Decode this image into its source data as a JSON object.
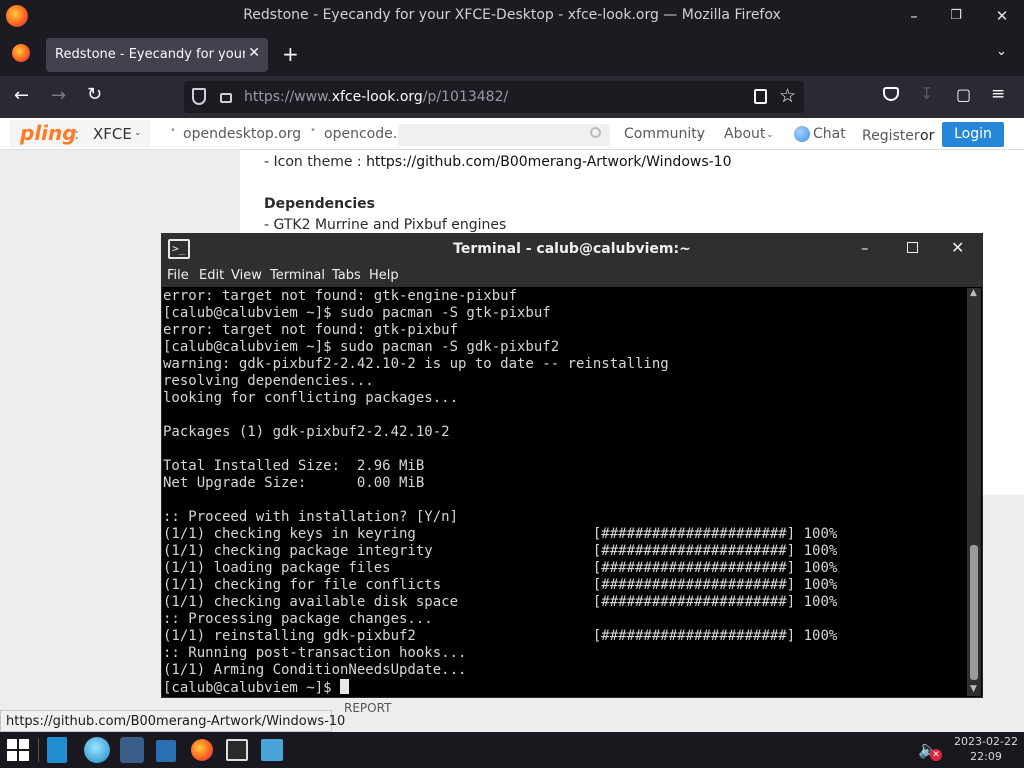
{
  "browser": {
    "window_title": "Redstone - Eyecandy for your XFCE-Desktop - xfce-look.org — Mozilla Firefox",
    "tab_title": "Redstone - Eyecandy for your XFCE-Desktop",
    "url_prefix": "https://www.",
    "url_domain": "xfce-look.org",
    "url_path": "/p/1013482/"
  },
  "site": {
    "logo": "pling",
    "section": "XFCE",
    "links": [
      "opendesktop.org",
      "opencode.net"
    ],
    "community": "Community",
    "about": "About",
    "chat": "Chat",
    "register": "Register",
    "or": "or",
    "login": "Login",
    "icon_theme_label": "- Icon theme : ",
    "icon_theme_link": "https://github.com/B00merang-Artwork/Windows-10",
    "deps_heading": "Dependencies",
    "deps_item": "- GTK2 Murrine and Pixbuf engines",
    "report": "REPORT"
  },
  "terminal": {
    "title": "Terminal - calub@calubviem:~",
    "menu": [
      "File",
      "Edit",
      "View",
      "Terminal",
      "Tabs",
      "Help"
    ],
    "lines": [
      "error: target not found: gtk-engine-pixbuf",
      "[calub@calubviem ~]$ sudo pacman -S gtk-pixbuf",
      "error: target not found: gtk-pixbuf",
      "[calub@calubviem ~]$ sudo pacman -S gdk-pixbuf2",
      "warning: gdk-pixbuf2-2.42.10-2 is up to date -- reinstalling",
      "resolving dependencies...",
      "looking for conflicting packages...",
      "",
      "Packages (1) gdk-pixbuf2-2.42.10-2",
      "",
      "Total Installed Size:  2.96 MiB",
      "Net Upgrade Size:      0.00 MiB",
      "",
      ":: Proceed with installation? [Y/n]",
      "(1/1) checking keys in keyring                     [######################] 100%",
      "(1/1) checking package integrity                   [######################] 100%",
      "(1/1) loading package files                        [######################] 100%",
      "(1/1) checking for file conflicts                  [######################] 100%",
      "(1/1) checking available disk space                [######################] 100%",
      ":: Processing package changes...",
      "(1/1) reinstalling gdk-pixbuf2                     [######################] 100%",
      ":: Running post-transaction hooks...",
      "(1/1) Arming ConditionNeedsUpdate...",
      "[calub@calubviem ~]$ "
    ]
  },
  "status_link": "https://github.com/B00merang-Artwork/Windows-10",
  "clock": {
    "date": "2023-02-22",
    "time": "22:09"
  }
}
